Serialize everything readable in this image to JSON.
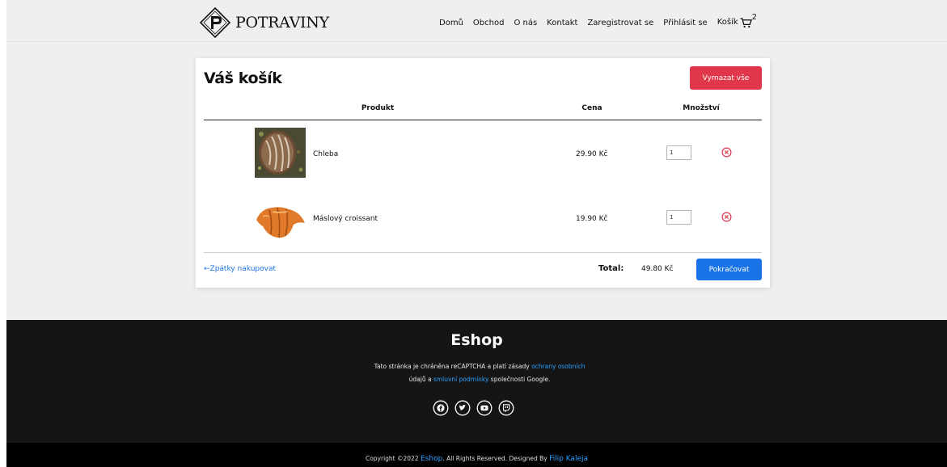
{
  "nav": {
    "brand": "POTRAVINY",
    "links": [
      "Domů",
      "Obchod",
      "O nás",
      "Kontakt",
      "Zaregistrovat se",
      "Přihlásit se"
    ],
    "cart_label": "Košík",
    "cart_count": "2"
  },
  "cart": {
    "title": "Váš košík",
    "clear_button": "Vymazat vše",
    "columns": {
      "product": "Produkt",
      "price": "Cena",
      "quantity": "Množství"
    },
    "items": [
      {
        "name": "Chleba",
        "price": "29.90 Kč",
        "quantity": "1"
      },
      {
        "name": "Máslový croissant",
        "price": "19.90 Kč",
        "quantity": "1"
      }
    ],
    "back_link": "←Zpátky nakupovat",
    "total_label": "Total:",
    "total_value": "49.80 Kč",
    "continue_button": "Pokračovat"
  },
  "footer": {
    "title": "Eshop",
    "text_1": "Tato stránka je chráněna reCAPTCHA a platí zásady ",
    "link_1": "ochrany osobních",
    "text_2": "údajů a ",
    "link_2": "smluvní podmínky",
    "text_3": " společnosti Google.",
    "socials": [
      "facebook-icon",
      "twitter-icon",
      "youtube-icon",
      "twitch-icon"
    ]
  },
  "copyright": {
    "prefix": "Copyright ©2022 ",
    "brand": "Eshop",
    "middle": ". All Rights Reserved. Designed By ",
    "author": "Filip Kaleja"
  },
  "colors": {
    "danger": "#e0374a",
    "primary": "#1a73e8",
    "link": "#2aa0ff",
    "footer_bg": "#151515"
  }
}
